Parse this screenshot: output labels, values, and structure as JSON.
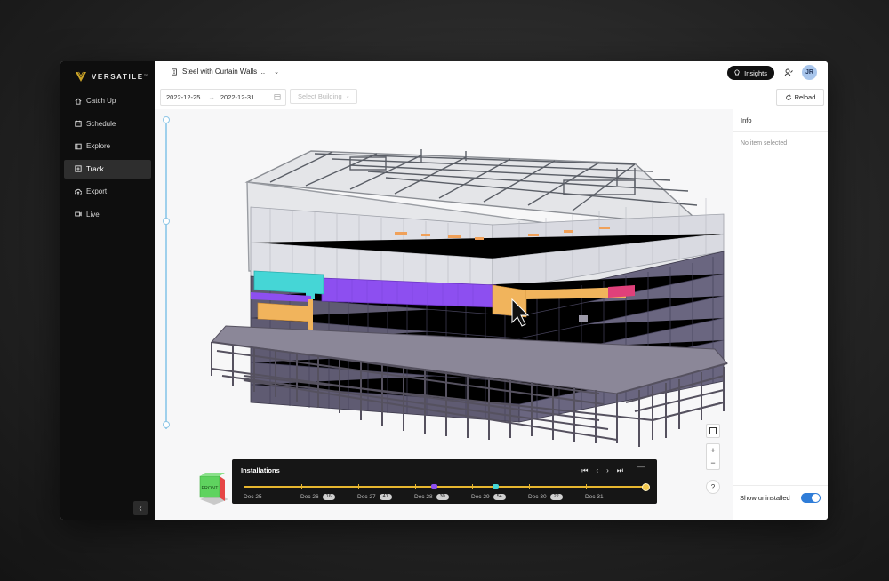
{
  "brand": {
    "name": "VERSATILE",
    "tm": "™",
    "logo_color": "#c9a227"
  },
  "sidebar": {
    "items": [
      {
        "label": "Catch Up",
        "icon": "home-icon"
      },
      {
        "label": "Schedule",
        "icon": "calendar-icon"
      },
      {
        "label": "Explore",
        "icon": "explore-icon"
      },
      {
        "label": "Track",
        "icon": "track-icon",
        "active": true
      },
      {
        "label": "Export",
        "icon": "cloud-upload-icon"
      },
      {
        "label": "Live",
        "icon": "video-icon"
      }
    ],
    "collapse_icon": "chevron-left-icon"
  },
  "header": {
    "project_name": "Steel with Curtain Walls ...",
    "insights_label": "Insights",
    "avatar_initials": "JR"
  },
  "toolbar": {
    "start_date": "2022-12-25",
    "end_date": "2022-12-31",
    "range_arrow": "→",
    "building_placeholder": "Select Building",
    "reload_label": "Reload"
  },
  "viewer": {
    "zoom_in": "+",
    "zoom_out": "−",
    "help": "?",
    "cube_face": "FRONT",
    "colors": {
      "purple": "#8d4ff0",
      "cyan": "#45d6d6",
      "orange": "#f1b45c",
      "pink": "#e0407a"
    }
  },
  "installations": {
    "title": "Installations",
    "minimize": "—",
    "days": [
      {
        "label": "Dec 25",
        "count": ""
      },
      {
        "label": "Dec 26",
        "count": "16"
      },
      {
        "label": "Dec 27",
        "count": "41"
      },
      {
        "label": "Dec 28",
        "count": "30"
      },
      {
        "label": "Dec 29",
        "count": "54"
      },
      {
        "label": "Dec 30",
        "count": "22"
      },
      {
        "label": "Dec 31",
        "count": ""
      }
    ],
    "track_color": "#e7b62f"
  },
  "info": {
    "title": "Info",
    "empty_text": "No item selected",
    "show_uninstalled_label": "Show uninstalled",
    "show_uninstalled": true
  }
}
